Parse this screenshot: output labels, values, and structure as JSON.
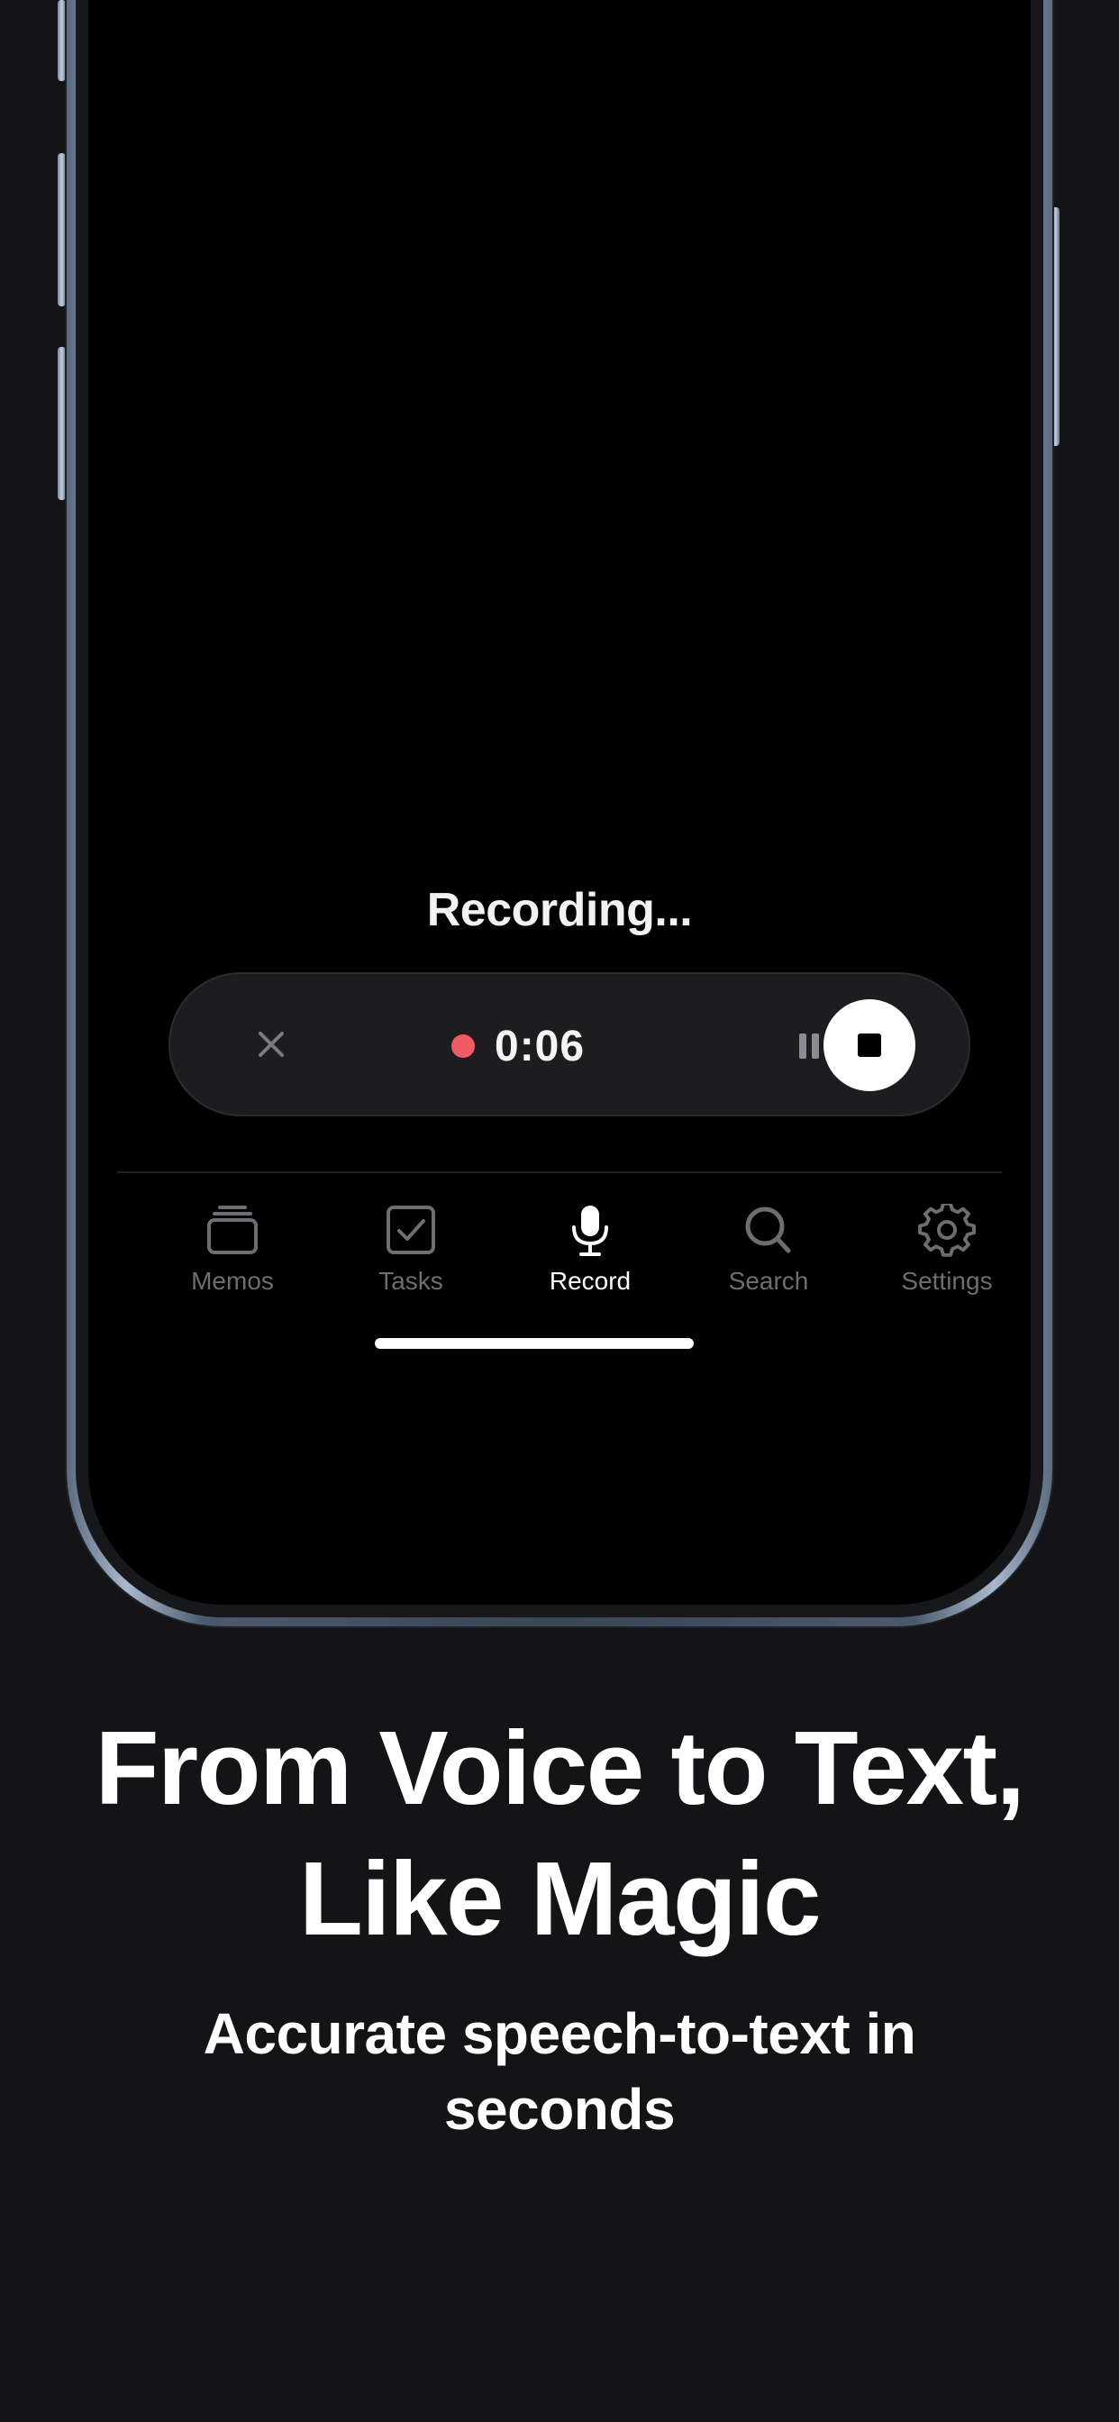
{
  "screen": {
    "recording_label": "Recording...",
    "timer": "0:06",
    "accent": "#f05a63"
  },
  "tabbar": {
    "items": [
      {
        "label": "Memos",
        "icon": "stack-icon",
        "active": false
      },
      {
        "label": "Tasks",
        "icon": "checkbox-icon",
        "active": false
      },
      {
        "label": "Record",
        "icon": "microphone-icon",
        "active": true
      },
      {
        "label": "Search",
        "icon": "magnifier-icon",
        "active": false
      },
      {
        "label": "Settings",
        "icon": "gear-icon",
        "active": false
      }
    ]
  },
  "promo": {
    "headline_line1": "From Voice to Text,",
    "headline_line2": "Like Magic",
    "subhead_line1": "Accurate speech-to-text in",
    "subhead_line2": "seconds"
  }
}
